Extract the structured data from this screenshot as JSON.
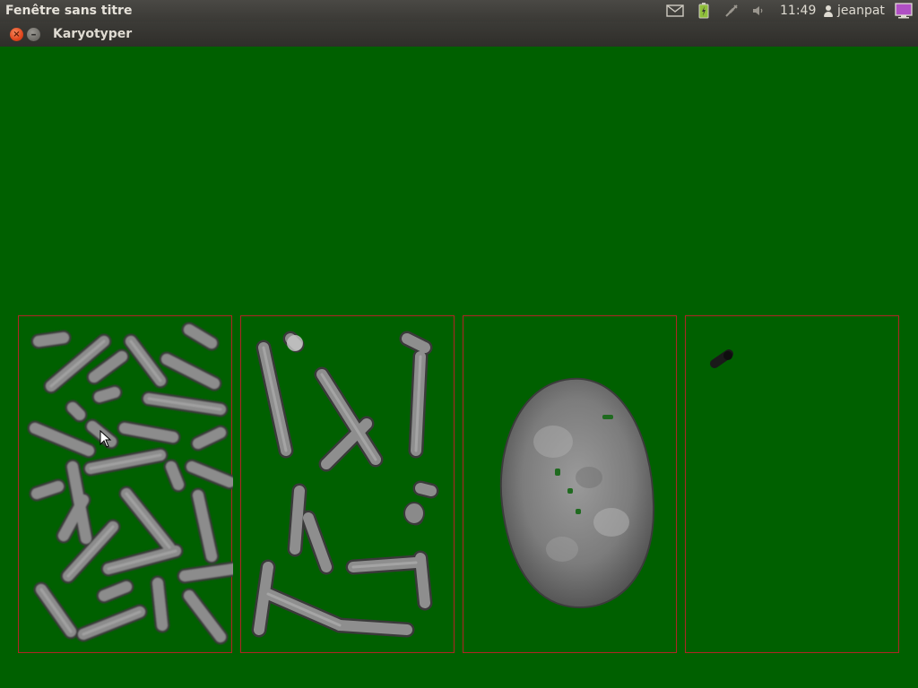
{
  "panel": {
    "window_title": "Fenêtre sans titre",
    "clock": "11:49",
    "user": "jeanpat",
    "indicators": [
      "mail-icon",
      "battery-icon",
      "network-icon",
      "volume-icon",
      "session-icon"
    ]
  },
  "window": {
    "title": "Karyotyper",
    "close_glyph": "×",
    "minimize_glyph": "–"
  },
  "colors": {
    "background": "#006000",
    "frame_border": "#b02525",
    "chromosome": "#8a8a8a"
  },
  "frames": [
    {
      "name": "chromosome-spread-frame"
    },
    {
      "name": "selected-chromosomes-frame"
    },
    {
      "name": "nucleus-frame"
    },
    {
      "name": "small-object-frame"
    }
  ]
}
